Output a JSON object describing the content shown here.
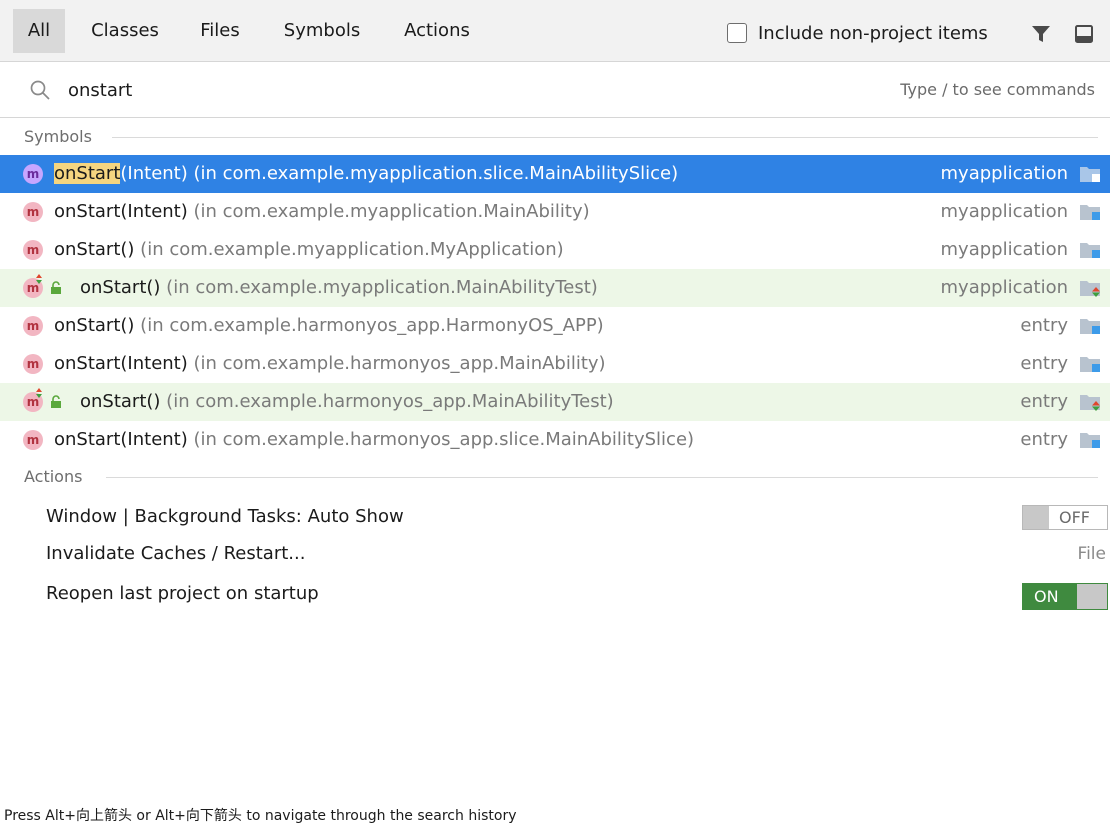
{
  "tabs": [
    {
      "label": "All",
      "active": true
    },
    {
      "label": "Classes"
    },
    {
      "label": "Files"
    },
    {
      "label": "Symbols"
    },
    {
      "label": "Actions"
    }
  ],
  "include_non_project": {
    "label": "Include non-project items",
    "checked": false
  },
  "toolbar_icons": [
    "filter-icon",
    "window-icon"
  ],
  "search": {
    "value": "onstart",
    "hint": "Type / to see commands",
    "icon": "search-icon"
  },
  "sections": {
    "symbols": "Symbols",
    "actions": "Actions"
  },
  "symbols": [
    {
      "name": "onStart(Intent)",
      "match": "onStart",
      "rest": "(Intent)",
      "location": "(in com.example.myapplication.slice.MainAbilitySlice)",
      "module": "myapplication",
      "selected": true,
      "test": false
    },
    {
      "name": "onStart(Intent)",
      "location": "(in com.example.myapplication.MainAbility)",
      "module": "myapplication",
      "selected": false,
      "test": false
    },
    {
      "name": "onStart()",
      "location": "(in com.example.myapplication.MyApplication)",
      "module": "myapplication",
      "selected": false,
      "test": false
    },
    {
      "name": "onStart()",
      "location": "(in com.example.myapplication.MainAbilityTest)",
      "module": "myapplication",
      "selected": false,
      "test": true
    },
    {
      "name": "onStart()",
      "location": "(in com.example.harmonyos_app.HarmonyOS_APP)",
      "module": "entry",
      "selected": false,
      "test": false
    },
    {
      "name": "onStart(Intent)",
      "location": "(in com.example.harmonyos_app.MainAbility)",
      "module": "entry",
      "selected": false,
      "test": false
    },
    {
      "name": "onStart()",
      "location": "(in com.example.harmonyos_app.MainAbilityTest)",
      "module": "entry",
      "selected": false,
      "test": true
    },
    {
      "name": "onStart(Intent)",
      "location": "(in com.example.harmonyos_app.slice.MainAbilitySlice)",
      "module": "entry",
      "selected": false,
      "test": false
    }
  ],
  "method_icon_letter": "m",
  "actions": [
    {
      "label": "Window | Background Tasks: Auto Show",
      "toggle": "OFF"
    },
    {
      "label": "Invalidate Caches / Restart...",
      "side": "File"
    },
    {
      "label": "Reopen last project on startup",
      "toggle": "ON"
    }
  ],
  "footer": "Press Alt+向上箭头 or Alt+向下箭头 to navigate through the search history",
  "colors": {
    "selection": "#2f82e4",
    "test_row": "#edf7e7",
    "toggle_on": "#3f8a3f",
    "highlight": "#f5d580"
  }
}
